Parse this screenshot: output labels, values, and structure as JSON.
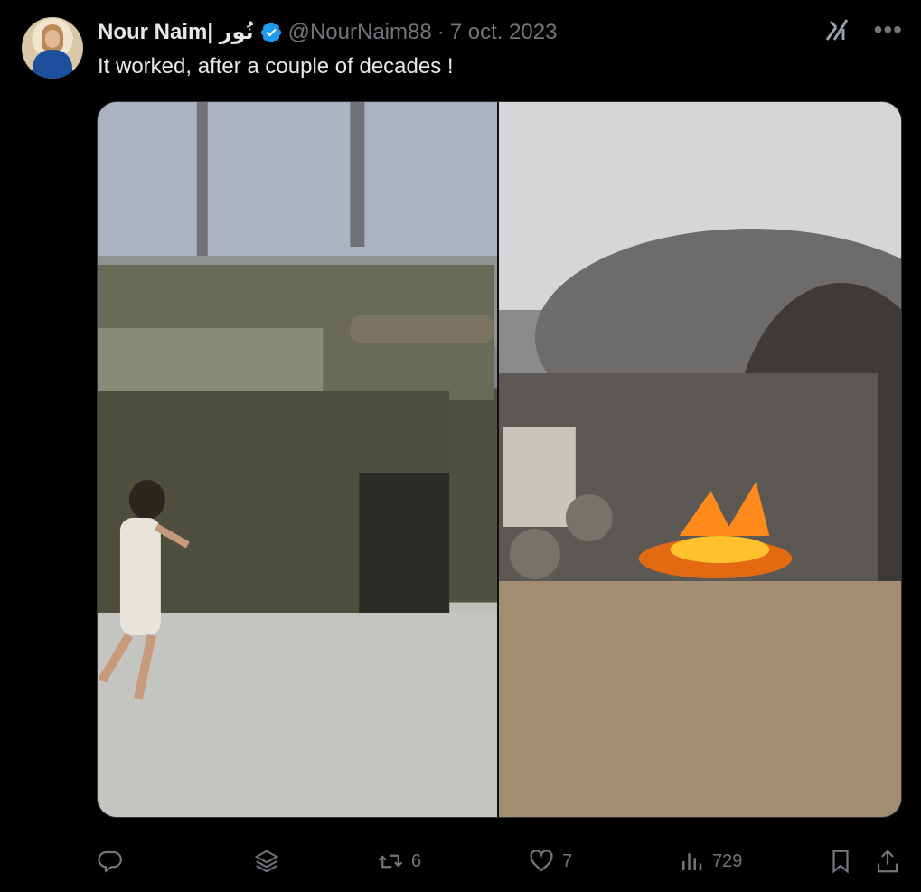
{
  "author": {
    "name": "Nour Naim| نُور",
    "handle": "@NourNaim88",
    "separator": "·",
    "date": "7 oct. 2023",
    "verified_color": "#1d9bf0"
  },
  "tweet": {
    "text": "It worked, after a couple of decades !"
  },
  "icons": {
    "grok": "grok-icon",
    "more": "more-icon",
    "reply": "reply-icon",
    "layers": "layers-icon",
    "retweet": "retweet-icon",
    "like": "heart-icon",
    "views": "views-icon",
    "bookmark": "bookmark-icon",
    "share": "share-icon"
  },
  "metrics": {
    "retweets": "6",
    "likes": "7",
    "views": "729"
  },
  "colors": {
    "background": "#000000",
    "text": "#e7e9ea",
    "muted": "#71767b",
    "accent": "#1d9bf0"
  }
}
